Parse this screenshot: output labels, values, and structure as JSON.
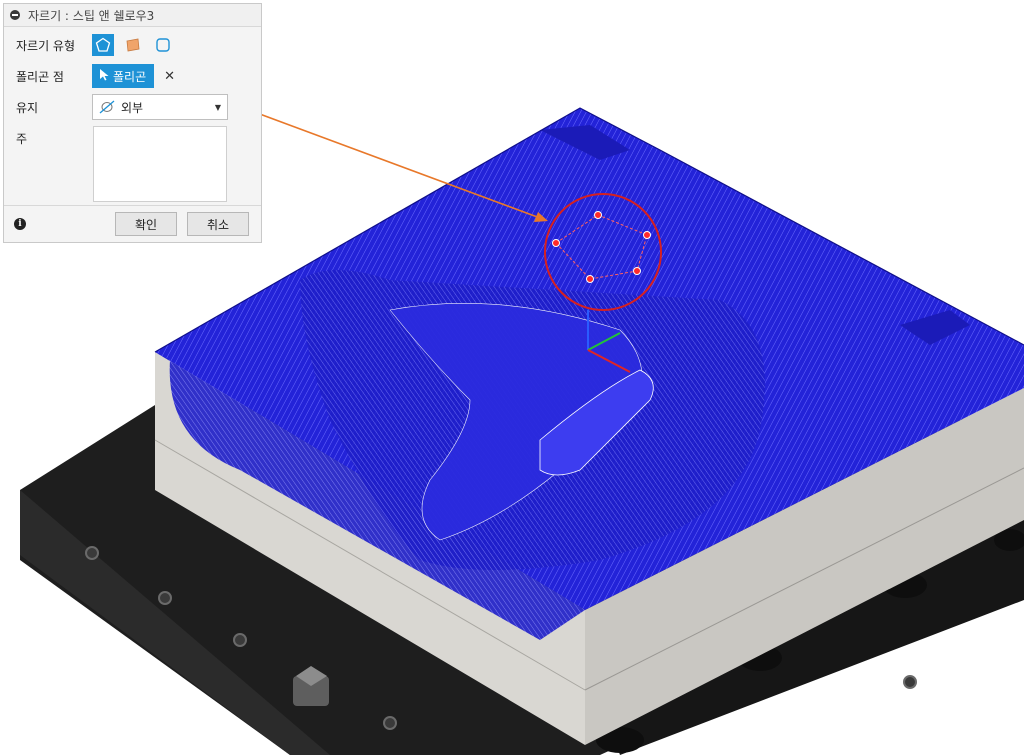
{
  "dialog": {
    "title": "자르기 : 스팁 앤 쉘로우3",
    "clipper_type_label": "자르기 유형",
    "polygon_points_label": "폴리곤 점",
    "polygon_button_label": "폴리곤",
    "keep_label": "유지",
    "keep_value": "외부",
    "note_label": "주",
    "note_value": "",
    "ok_label": "확인",
    "cancel_label": "취소"
  },
  "icons": {
    "clipper_types": [
      "polygon-icon",
      "plane-icon",
      "box-icon"
    ],
    "polygon_button": "pointer-cursor-icon",
    "clear": "close-icon",
    "keep": "outside-icon",
    "info": "info-icon"
  },
  "colors": {
    "accent": "#1e92d6",
    "toolpath": "#2a2ad9",
    "callout_arrow": "#e8782a",
    "selection_circle": "#d62020",
    "polygon_points": "#e02020"
  }
}
